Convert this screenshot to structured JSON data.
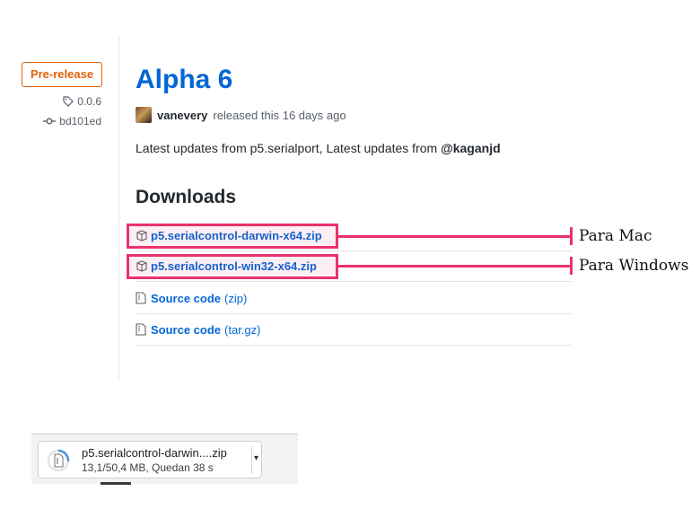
{
  "release": {
    "badge": "Pre-release",
    "tag": "0.0.6",
    "commit": "bd101ed",
    "title": "Alpha 6",
    "author": "vanevery",
    "released_text": "released this 16 days ago",
    "description_prefix": "Latest updates from p5.serialport, Latest updates from ",
    "description_mention": "@kaganjd"
  },
  "downloads": {
    "heading": "Downloads",
    "assets": [
      {
        "label": "p5.serialcontrol-darwin-x64.zip",
        "ext": ""
      },
      {
        "label": "p5.serialcontrol-win32-x64.zip",
        "ext": ""
      },
      {
        "label": "Source code",
        "ext": "(zip)"
      },
      {
        "label": "Source code",
        "ext": "(tar.gz)"
      }
    ]
  },
  "callouts": {
    "mac": "Para Mac",
    "windows": "Para Windows"
  },
  "download_bar": {
    "filename": "p5.serialcontrol-darwin....zip",
    "status": "13,1/50,4 MB, Quedan 38 s",
    "progress_fraction": 0.26
  },
  "colors": {
    "link": "#0366d6",
    "prerelease": "#e36209",
    "highlight": "#e8336b"
  }
}
